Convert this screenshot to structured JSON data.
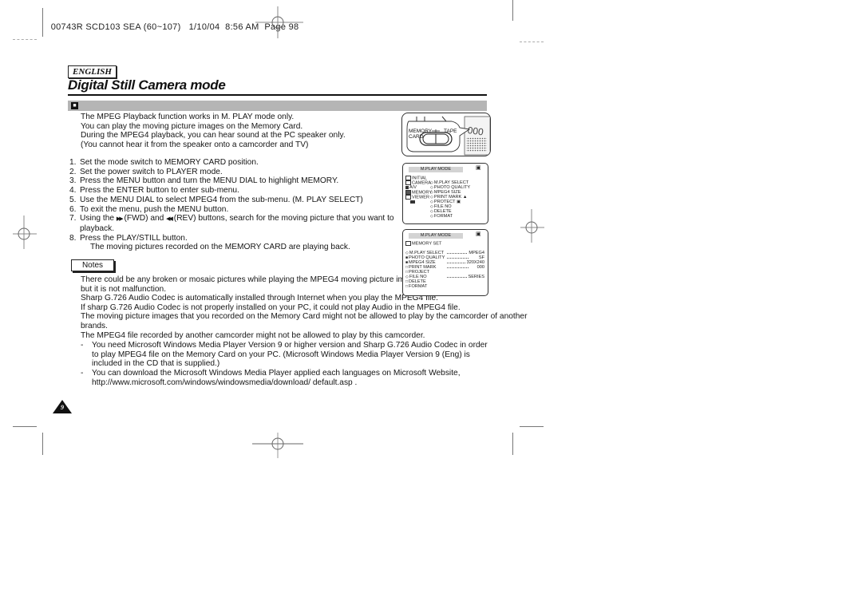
{
  "print_header": {
    "job": "00743R SCD103 SEA (60~107)",
    "date": "1/10/04",
    "time": "8:56 AM",
    "page_label": "Page",
    "page_number": "98"
  },
  "language_tab": "ENGLISH",
  "page_title": "Digital Still Camera mode",
  "section_icon": "mpeg-playback-icon",
  "intro": [
    "The MPEG Playback function works in M. PLAY mode only.",
    "You can play the moving picture images on the Memory Card.",
    "During the MPEG4 playback, you can hear sound at the PC speaker only.",
    "(You cannot hear it from the speaker onto a camcorder and TV)"
  ],
  "steps": [
    {
      "num": "1.",
      "text": "Set the mode switch to MEMORY CARD position."
    },
    {
      "num": "2.",
      "text": "Set the power switch to PLAYER mode."
    },
    {
      "num": "3.",
      "text": "Press the MENU button and turn the MENU DIAL to highlight MEMORY."
    },
    {
      "num": "4.",
      "text": "Press the ENTER button to enter sub-menu."
    },
    {
      "num": "5.",
      "text": "Use the MENU DIAL to select MPEG4 from the sub-menu. (M. PLAY SELECT)"
    },
    {
      "num": "6.",
      "text": "To exit the menu, push the MENU button."
    },
    {
      "num": "7.",
      "text_a": "Using the",
      "fwd_icon": "▶▶",
      "text_b": "(FWD) and",
      "rev_icon": "◀◀",
      "text_c": "(REV) buttons, search for the moving picture that you want to",
      "text_d": "playback."
    },
    {
      "num": "8.",
      "text": "Press the PLAY/STILL button.",
      "subtext": "The moving pictures recorded on the MEMORY CARD are playing back."
    }
  ],
  "notes": {
    "label": "Notes",
    "lines": [
      "There could be any broken or mosaic pictures while playing the MPEG4 moving picture images,",
      "but it is not malfunction.",
      "Sharp G.726 Audio Codec is automatically installed through Internet when you play the MPEG4 file.",
      "If sharp G.726 Audio Codec is not properly installed on your PC, it could not play Audio in the MPEG4 file.",
      "The moving picture images that you recorded on the Memory Card might not be allowed to play by the camcorder of another",
      "brands.",
      "The MPEG4 file recorded by another camcorder might not be allowed to play by this camcorder."
    ],
    "dash_items": [
      {
        "bullet": "-",
        "text": "You need Microsoft Windows Media Player Version 9 or higher version and Sharp G.726 Audio Codec in order to play MPEG4 file on the Memory Card on your PC. (Microsoft Windows Media Player Version 9 (Eng) is included in the CD that is supplied.)"
      },
      {
        "bullet": "-",
        "text": "You can download the Microsoft Windows Media Player applied each languages on Microsoft Website,",
        "url": "http://www.microsoft.com/windows/windowsmedia/download/ default.asp ."
      }
    ]
  },
  "camera_illustration": {
    "label_memory": "MEMORY",
    "label_card": "CARD",
    "label_tape": "TAPE"
  },
  "screen1": {
    "header": "M.PLAY MODE",
    "mode_badge": "▣",
    "left_menu": [
      "INITIAL",
      "CAMERA",
      "A/V",
      "MEMORY",
      "VIEWER"
    ],
    "right_menu": [
      "M.PLAY SELECT",
      "PHOTO QUALITY",
      "MPEG4 SIZE",
      "PRINT MARK",
      "PROTECT",
      "FILE NO",
      "DELETE",
      "FORMAT"
    ]
  },
  "screen2": {
    "header": "M.PLAY MODE",
    "mode_badge": "▣",
    "section": "MEMORY SET",
    "rows": [
      {
        "label": "M.PLAY SELECT",
        "value": "MPEG4"
      },
      {
        "label": "PHOTO QUALITY",
        "value": "SF"
      },
      {
        "label": "MPEG4 SIZE",
        "value": "320X240"
      },
      {
        "label": "PRINT MARK",
        "value": "000"
      },
      {
        "label": "PROJECT",
        "value": ""
      },
      {
        "label": "FILE NO",
        "value": "SERIES"
      },
      {
        "label": "DELETE",
        "value": ""
      },
      {
        "label": "FORMAT",
        "value": ""
      }
    ]
  },
  "page_number": "9"
}
